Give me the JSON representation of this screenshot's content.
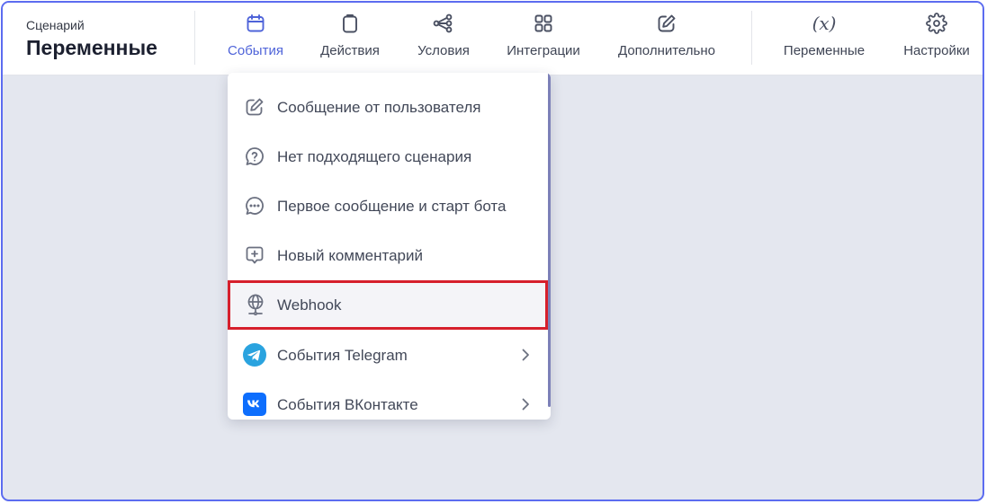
{
  "header": {
    "caption": "Сценарий",
    "title": "Переменные"
  },
  "nav": [
    {
      "label": "События",
      "icon": "calendar-icon",
      "active": true
    },
    {
      "label": "Действия",
      "icon": "clipboard-icon",
      "active": false
    },
    {
      "label": "Условия",
      "icon": "branch-icon",
      "active": false
    },
    {
      "label": "Интеграции",
      "icon": "grid-icon",
      "active": false
    },
    {
      "label": "Дополнительно",
      "icon": "edit-icon",
      "active": false
    }
  ],
  "nav_right": [
    {
      "label": "Переменные",
      "icon": "variable-icon",
      "glyph": "(x)"
    },
    {
      "label": "Настройки",
      "icon": "gear-icon"
    }
  ],
  "dropdown": {
    "items": [
      {
        "label": "Сообщение от пользователя",
        "icon": "pencil-square-icon",
        "submenu": false
      },
      {
        "label": "Нет подходящего сценария",
        "icon": "question-bubble-icon",
        "submenu": false
      },
      {
        "label": "Первое сообщение и старт бота",
        "icon": "dots-bubble-icon",
        "submenu": false
      },
      {
        "label": "Новый комментарий",
        "icon": "plus-bubble-icon",
        "submenu": false
      },
      {
        "label": "Webhook",
        "icon": "globe-icon",
        "submenu": false,
        "highlighted": true
      },
      {
        "label": "События Telegram",
        "icon": "telegram-icon",
        "submenu": true
      },
      {
        "label": "События ВКонтакте",
        "icon": "vk-icon",
        "submenu": true
      }
    ]
  },
  "colors": {
    "accent": "#4e63d9",
    "frame_border": "#5c6cf0",
    "highlight_border": "#d61f2c",
    "canvas_bg": "#e4e7ef",
    "telegram": "#2aa3df",
    "vk": "#0d6efd"
  }
}
